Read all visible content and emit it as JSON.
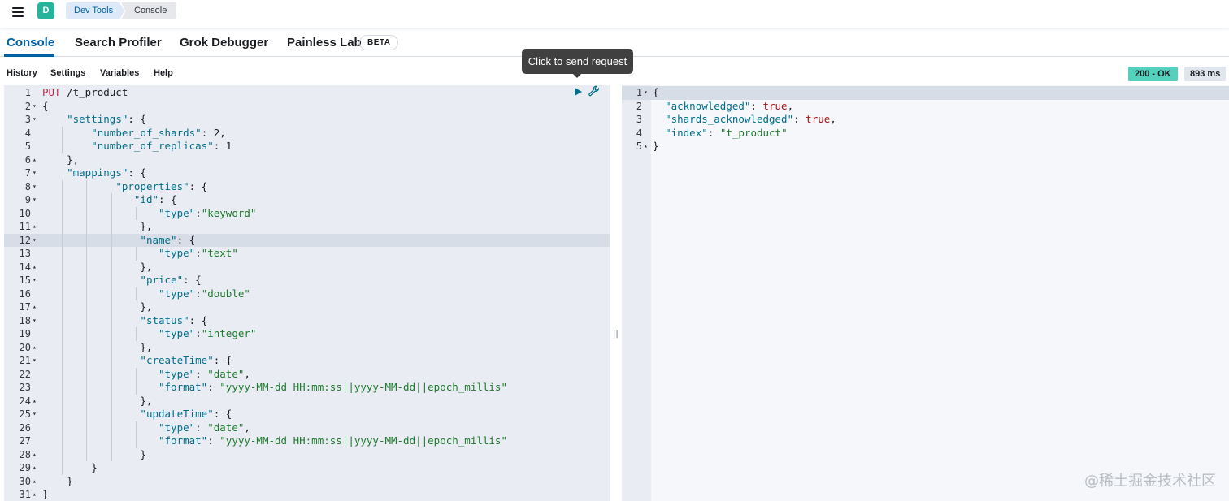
{
  "header": {
    "avatar_letter": "D",
    "breadcrumbs": [
      "Dev Tools",
      "Console"
    ]
  },
  "tabs": [
    {
      "label": "Console",
      "active": true
    },
    {
      "label": "Search Profiler",
      "active": false
    },
    {
      "label": "Grok Debugger",
      "active": false
    },
    {
      "label": "Painless Lab",
      "active": false
    }
  ],
  "beta_label": "BETA",
  "toolbar": {
    "items": [
      "History",
      "Settings",
      "Variables",
      "Help"
    ],
    "status": "200 - OK",
    "duration": "893 ms"
  },
  "tooltip": "Click to send request",
  "colors": {
    "accent": "#0061a6",
    "status_ok": "#54d1bd",
    "string": "#1d7b2c",
    "key": "#006e8a",
    "method": "#c7254e"
  },
  "request_lines": [
    {
      "n": "1",
      "fold": "",
      "text": "PUT /t_product"
    },
    {
      "n": "2",
      "fold": "▾",
      "text": "{"
    },
    {
      "n": "3",
      "fold": "▾",
      "text": "    \"settings\": {"
    },
    {
      "n": "4",
      "fold": "",
      "text": "        \"number_of_shards\": 2,"
    },
    {
      "n": "5",
      "fold": "",
      "text": "        \"number_of_replicas\": 1"
    },
    {
      "n": "6",
      "fold": "▴",
      "text": "    },"
    },
    {
      "n": "7",
      "fold": "▾",
      "text": "    \"mappings\": {"
    },
    {
      "n": "8",
      "fold": "▾",
      "text": "            \"properties\": {"
    },
    {
      "n": "9",
      "fold": "▾",
      "text": "               \"id\": {"
    },
    {
      "n": "10",
      "fold": "",
      "text": "                   \"type\":\"keyword\""
    },
    {
      "n": "11",
      "fold": "▴",
      "text": "                },"
    },
    {
      "n": "12",
      "fold": "▾",
      "text": "                \"name\": {"
    },
    {
      "n": "13",
      "fold": "",
      "text": "                   \"type\":\"text\""
    },
    {
      "n": "14",
      "fold": "▴",
      "text": "                },"
    },
    {
      "n": "15",
      "fold": "▾",
      "text": "                \"price\": {"
    },
    {
      "n": "16",
      "fold": "",
      "text": "                   \"type\":\"double\""
    },
    {
      "n": "17",
      "fold": "▴",
      "text": "                },"
    },
    {
      "n": "18",
      "fold": "▾",
      "text": "                \"status\": {"
    },
    {
      "n": "19",
      "fold": "",
      "text": "                   \"type\":\"integer\""
    },
    {
      "n": "20",
      "fold": "▴",
      "text": "                },"
    },
    {
      "n": "21",
      "fold": "▾",
      "text": "                \"createTime\": {"
    },
    {
      "n": "22",
      "fold": "",
      "text": "                   \"type\": \"date\","
    },
    {
      "n": "23",
      "fold": "",
      "text": "                   \"format\": \"yyyy-MM-dd HH:mm:ss||yyyy-MM-dd||epoch_millis\""
    },
    {
      "n": "24",
      "fold": "▴",
      "text": "                },"
    },
    {
      "n": "25",
      "fold": "▾",
      "text": "                \"updateTime\": {"
    },
    {
      "n": "26",
      "fold": "",
      "text": "                   \"type\": \"date\","
    },
    {
      "n": "27",
      "fold": "",
      "text": "                   \"format\": \"yyyy-MM-dd HH:mm:ss||yyyy-MM-dd||epoch_millis\""
    },
    {
      "n": "28",
      "fold": "▴",
      "text": "                }"
    },
    {
      "n": "29",
      "fold": "▴",
      "text": "        }"
    },
    {
      "n": "30",
      "fold": "▴",
      "text": "    }"
    },
    {
      "n": "31",
      "fold": "▴",
      "text": "}"
    }
  ],
  "active_request_line": 12,
  "response_lines": [
    {
      "n": "1",
      "fold": "▾",
      "text": "{"
    },
    {
      "n": "2",
      "fold": "",
      "text": "  \"acknowledged\": true,"
    },
    {
      "n": "3",
      "fold": "",
      "text": "  \"shards_acknowledged\": true,"
    },
    {
      "n": "4",
      "fold": "",
      "text": "  \"index\": \"t_product\""
    },
    {
      "n": "5",
      "fold": "▴",
      "text": "}"
    }
  ],
  "watermark": "@稀土掘金技术社区"
}
